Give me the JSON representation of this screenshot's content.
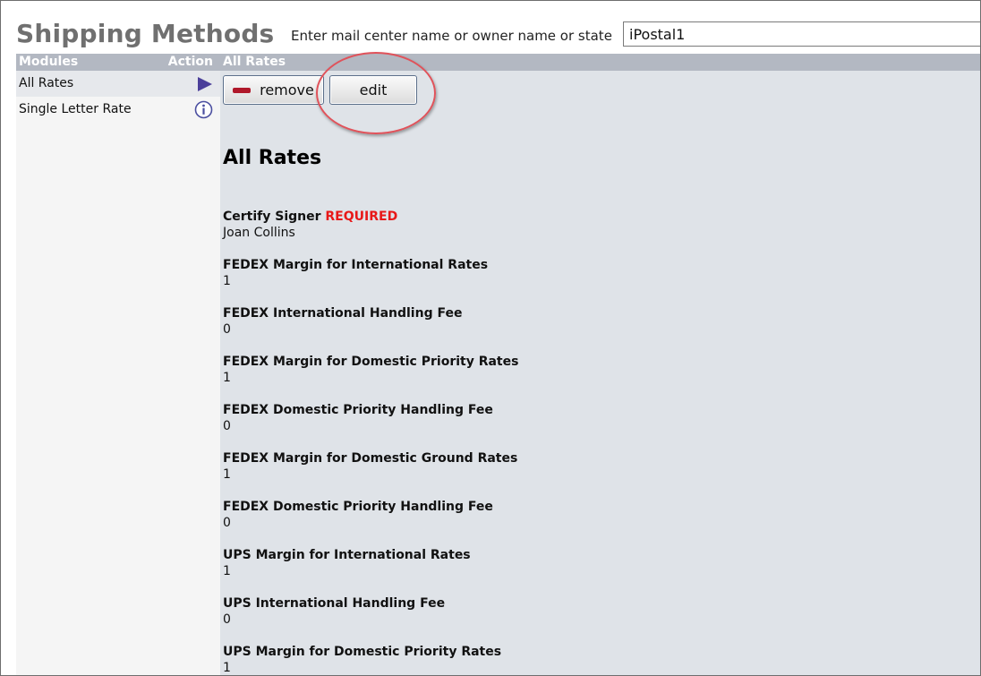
{
  "header": {
    "title": "Shipping Methods",
    "search_label": "Enter mail center name or owner name or state",
    "search_value": "iPostal1"
  },
  "sidebar": {
    "col_modules": "Modules",
    "col_action": "Action",
    "items": [
      {
        "label": "All Rates",
        "action_icon": "play-icon"
      },
      {
        "label": "Single Letter Rate",
        "action_icon": "info-icon"
      }
    ]
  },
  "main": {
    "header": "All Rates",
    "remove_label": "remove",
    "edit_label": "edit",
    "section_title": "All Rates",
    "required_color": "#e81818",
    "fields": [
      {
        "label": "Certify Signer",
        "required": "REQUIRED",
        "value": "Joan Collins"
      },
      {
        "label": "FEDEX Margin for International Rates",
        "value": "1"
      },
      {
        "label": "FEDEX International Handling Fee",
        "value": "0"
      },
      {
        "label": "FEDEX Margin for Domestic Priority Rates",
        "value": "1"
      },
      {
        "label": "FEDEX Domestic Priority Handling Fee",
        "value": "0"
      },
      {
        "label": "FEDEX Margin for Domestic Ground Rates",
        "value": "1"
      },
      {
        "label": "FEDEX Domestic Priority Handling Fee",
        "value": "0"
      },
      {
        "label": "UPS Margin for International Rates",
        "value": "1"
      },
      {
        "label": "UPS International Handling Fee",
        "value": "0"
      },
      {
        "label": "UPS Margin for Domestic Priority Rates",
        "value": "1"
      }
    ]
  }
}
